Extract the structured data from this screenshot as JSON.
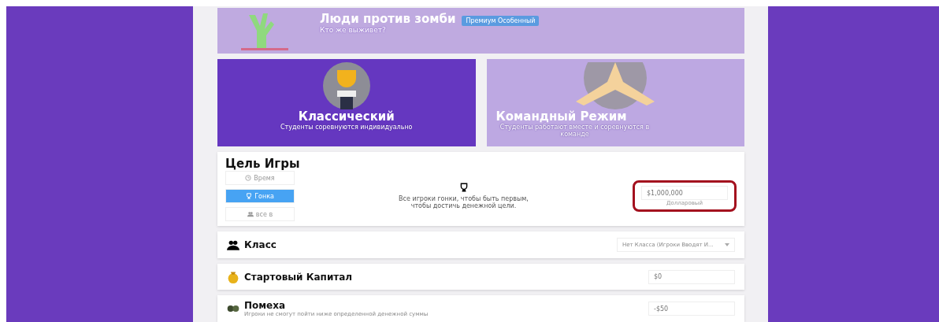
{
  "banner": {
    "title": "Люди против зомби",
    "subtitle": "Кто же выживет?",
    "badge": "Премиум Особенный"
  },
  "modes": [
    {
      "title": "Классический",
      "subtitle": "Студенты соревнуются индивидуально",
      "selected": true,
      "kind": "trophy"
    },
    {
      "title": "Командный Режим",
      "subtitle": "Студенты работают вместе и соревнуются в команде",
      "selected": false,
      "kind": "hands"
    }
  ],
  "goal": {
    "title": "Цель Игры",
    "options": [
      {
        "label": "Время",
        "selected": false,
        "kind": "clock"
      },
      {
        "label": "Гонка",
        "selected": true,
        "kind": "trophy"
      },
      {
        "label": "все в",
        "selected": false,
        "kind": "people"
      }
    ],
    "description": "Все игроки гонки, чтобы быть первым, чтобы достичь денежной цели.",
    "value": "$1,000,000",
    "value_label": "Долларовый",
    "highlighted": true
  },
  "settings": [
    {
      "kind": "select",
      "title": "Класс",
      "value": "Нет Класса (Игроки Вводят И..."
    },
    {
      "kind": "input",
      "title": "Стартовый Капитал",
      "value": "$0"
    },
    {
      "kind": "input",
      "title": "Помеха",
      "subtitle": "Игроки не смогут пойти ниже определенной денежной суммы",
      "value": "-$50"
    }
  ]
}
